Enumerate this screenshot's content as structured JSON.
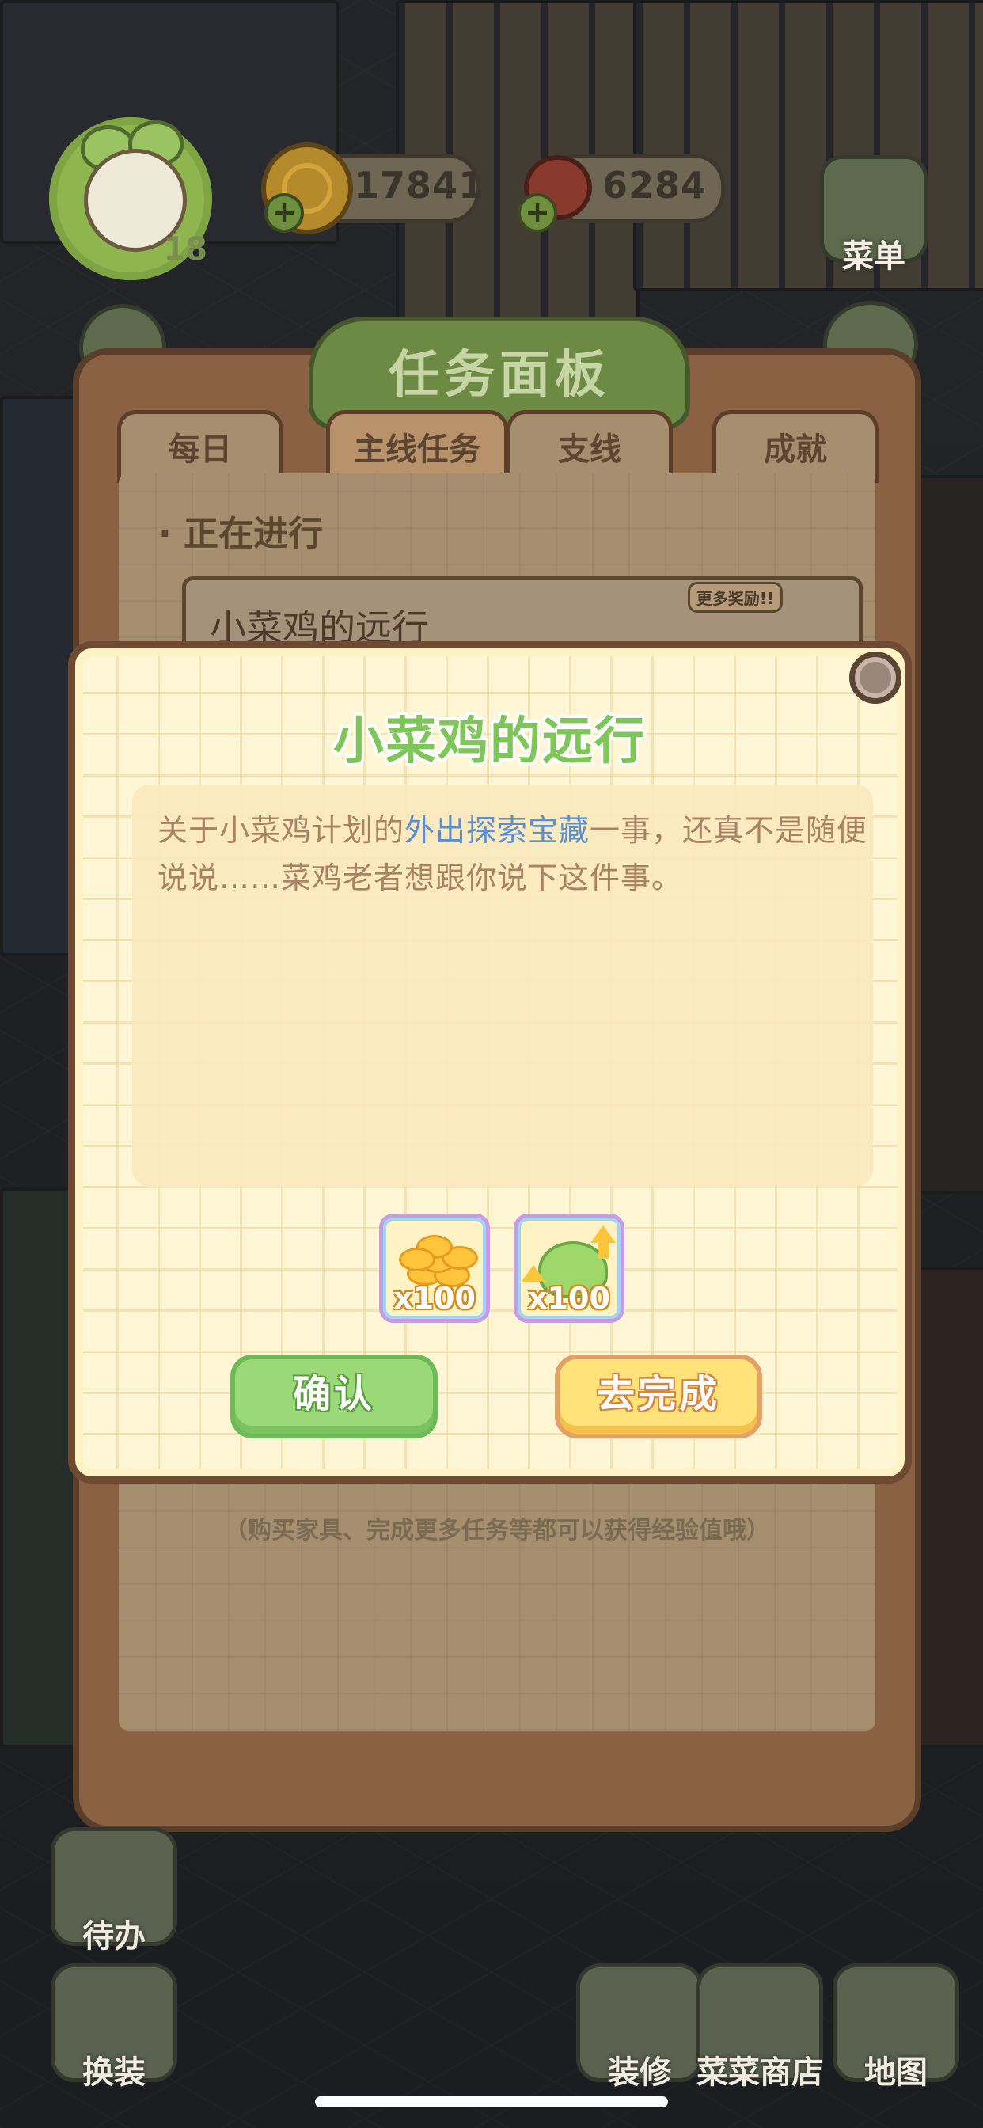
{
  "hud": {
    "level": "18",
    "coins": "17841",
    "meat": "6284",
    "menu_label": "菜单"
  },
  "panel": {
    "title": "任务面板",
    "tabs": [
      {
        "label": "每日"
      },
      {
        "label": "主线任务"
      },
      {
        "label": "支线"
      },
      {
        "label": "成就"
      }
    ],
    "in_progress_label": "· 正在进行",
    "task_name": "小菜鸡的远行",
    "more_rewards": "更多奖励!!",
    "hint": "（购买家具、完成更多任务等都可以获得经验值哦）"
  },
  "popup": {
    "title": "小菜鸡的远行",
    "desc_before": "关于小菜鸡计划的",
    "desc_highlight": "外出探索宝藏",
    "desc_after": "一事，还真不是随便说说……菜鸡老者想跟你说下这件事。",
    "rewards": [
      {
        "icon": "gold-coins-icon",
        "count": "x100"
      },
      {
        "icon": "vegetable-exp-icon",
        "count": "x100"
      }
    ],
    "confirm_label": "确认",
    "go_label": "去完成"
  },
  "bottom": {
    "todo_label": "待办",
    "dressup_label": "换装",
    "decorate_label": "装修",
    "shop_label": "菜菜商店",
    "map_label": "地图"
  },
  "colors": {
    "title_green": "#7fc65a",
    "highlight_blue": "#5a8fd1",
    "confirm_green": "#9bd878",
    "go_yellow": "#ffe37a"
  }
}
